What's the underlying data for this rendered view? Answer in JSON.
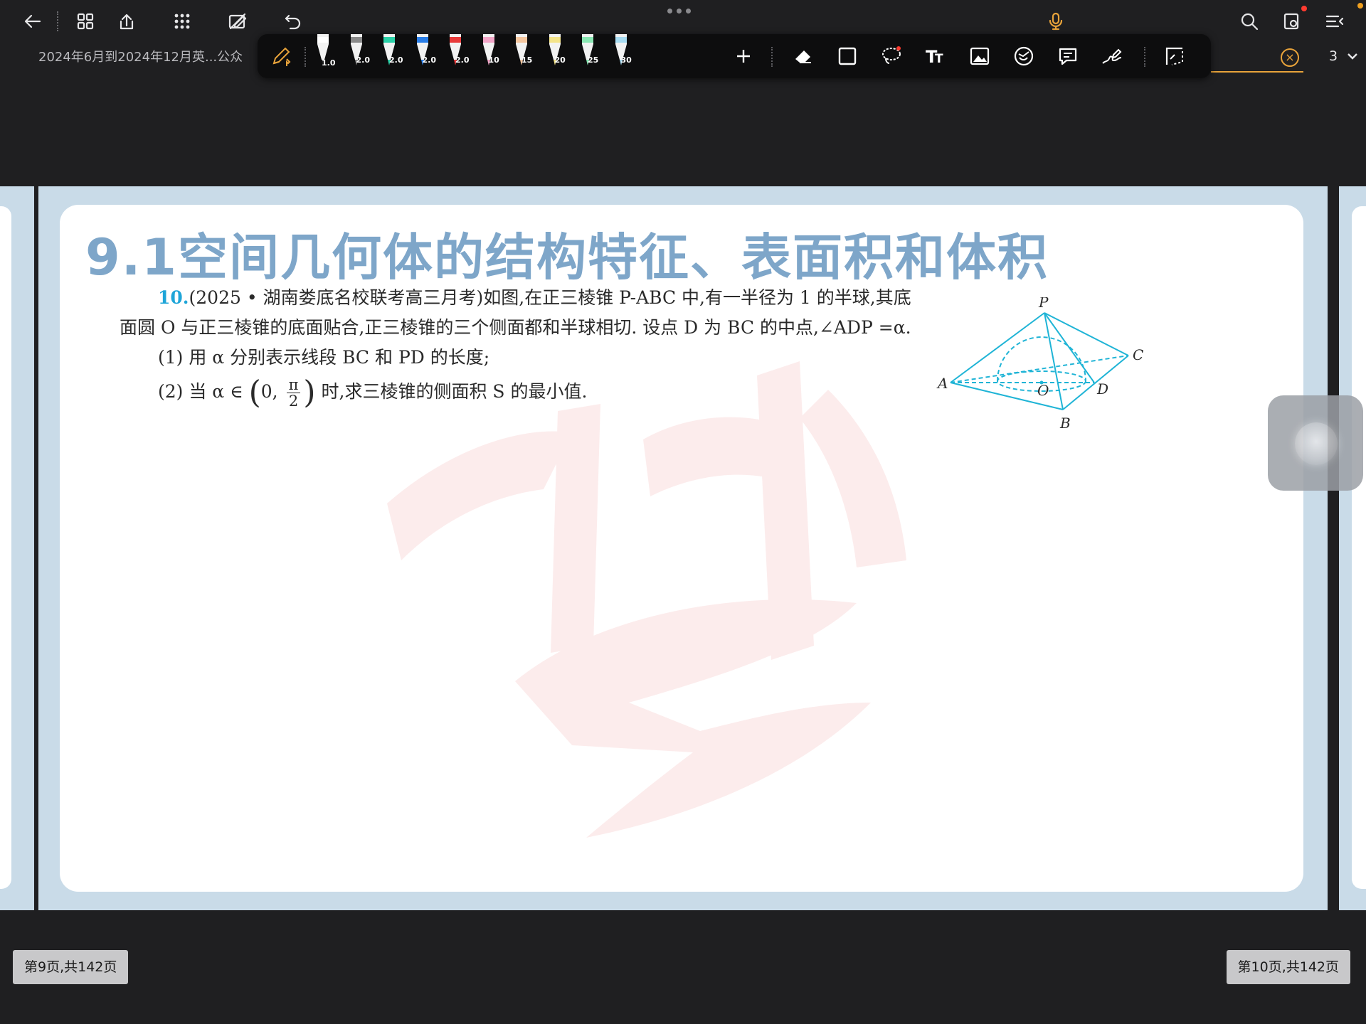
{
  "tab": {
    "title": "2024年6月到2024年12月英...公众",
    "page_count": "3"
  },
  "pen_toolbar": {
    "pens": [
      {
        "size": "1.0",
        "color": "#ffffff"
      },
      {
        "size": "2.0",
        "color": "#8a8a8a"
      },
      {
        "size": "2.0",
        "color": "#2ad1a8"
      },
      {
        "size": "2.0",
        "color": "#2a7ee8"
      },
      {
        "size": "2.0",
        "color": "#e83a3a"
      },
      {
        "size": "10",
        "color": "#f3a6c8"
      },
      {
        "size": "15",
        "color": "#f5c7a0"
      },
      {
        "size": "20",
        "color": "#f4e48a"
      },
      {
        "size": "25",
        "color": "#8ae8b4"
      },
      {
        "size": "30",
        "color": "#a8dcf2"
      }
    ],
    "accent_color": "#e8a33a"
  },
  "document": {
    "heading": "9.1空间几何体的结构特征、表面积和体积",
    "problem": {
      "number": "10.",
      "line1": "(2025 • 湖南娄底名校联考高三月考)如图,在正三棱锥 P-ABC 中,有一半径为 1 的半球,其底",
      "line2": "面圆 O 与正三棱锥的底面贴合,正三棱锥的三个侧面都和半球相切. 设点 D 为 BC 的中点,∠ADP =α.",
      "part1": "(1) 用 α 分别表示线段 BC 和 PD 的长度;",
      "part2_prefix": "(2) 当 α ∈",
      "part2_zero": "0,",
      "part2_num": "π",
      "part2_den": "2",
      "part2_suffix": "时,求三棱锥的侧面积 S 的最小值."
    },
    "figure_labels": {
      "P": "P",
      "A": "A",
      "B": "B",
      "C": "C",
      "D": "D",
      "O": "O"
    }
  },
  "footer": {
    "left_page": "第9页,共142页",
    "right_page": "第10页,共142页"
  }
}
